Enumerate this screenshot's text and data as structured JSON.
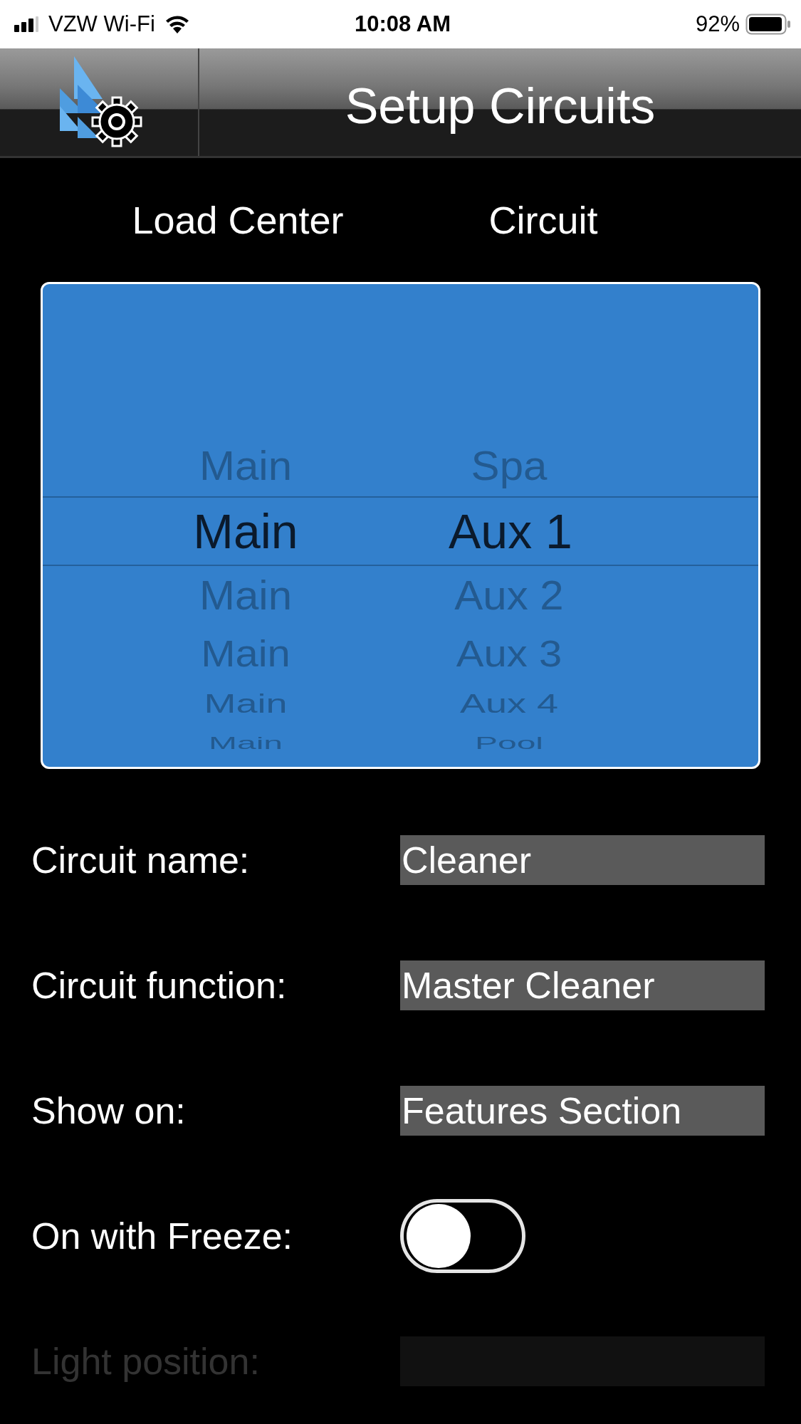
{
  "status_bar": {
    "carrier": "VZW Wi-Fi",
    "time": "10:08 AM",
    "battery": "92%"
  },
  "nav_bar": {
    "title": "Setup Circuits"
  },
  "picker": {
    "columns": [
      "Load Center",
      "Circuit"
    ],
    "rows": [
      {
        "load_center": "Main",
        "circuit": "Spa",
        "selected": false
      },
      {
        "load_center": "Main",
        "circuit": "Aux 1",
        "selected": true
      },
      {
        "load_center": "Main",
        "circuit": "Aux 2",
        "selected": false
      },
      {
        "load_center": "Main",
        "circuit": "Aux 3",
        "selected": false
      },
      {
        "load_center": "Main",
        "circuit": "Aux 4",
        "selected": false
      },
      {
        "load_center": "Main",
        "circuit": "Pool",
        "selected": false
      }
    ]
  },
  "settings": [
    {
      "kind": "field",
      "label": "Circuit name:",
      "value": "Cleaner",
      "disabled": false
    },
    {
      "kind": "field",
      "label": "Circuit function:",
      "value": "Master Cleaner",
      "disabled": false
    },
    {
      "kind": "field",
      "label": "Show on:",
      "value": "Features Section",
      "disabled": false
    },
    {
      "kind": "toggle",
      "label": "On with Freeze:",
      "on": false,
      "disabled": false
    },
    {
      "kind": "field",
      "label": "Light position:",
      "disabled": true
    }
  ]
}
